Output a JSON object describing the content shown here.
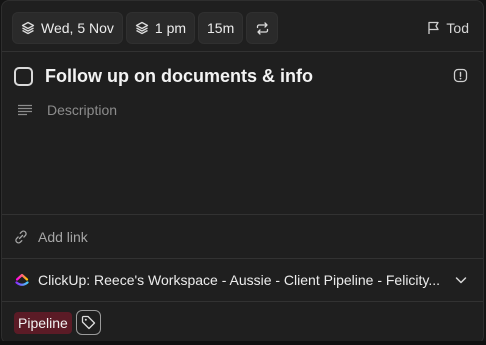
{
  "toolbar": {
    "date_label": "Wed, 5 Nov",
    "time_label": "1 pm",
    "duration_label": "15m",
    "repeat_icon": "repeat-icon",
    "flag_label": "Tod"
  },
  "task": {
    "title": "Follow up on documents & info",
    "description_placeholder": "Description"
  },
  "add_link_label": "Add link",
  "location": {
    "label": "ClickUp: Reece's Workspace - Aussie - Client Pipeline - Felicity..."
  },
  "tags": [
    {
      "label": "Pipeline",
      "color": "#5b1b26"
    }
  ],
  "colors": {
    "background": "#1f1f1f",
    "chip": "#2a2a2a",
    "tag_pipeline": "#5b1b26",
    "text": "#ececec",
    "muted": "#8c8c8c"
  }
}
